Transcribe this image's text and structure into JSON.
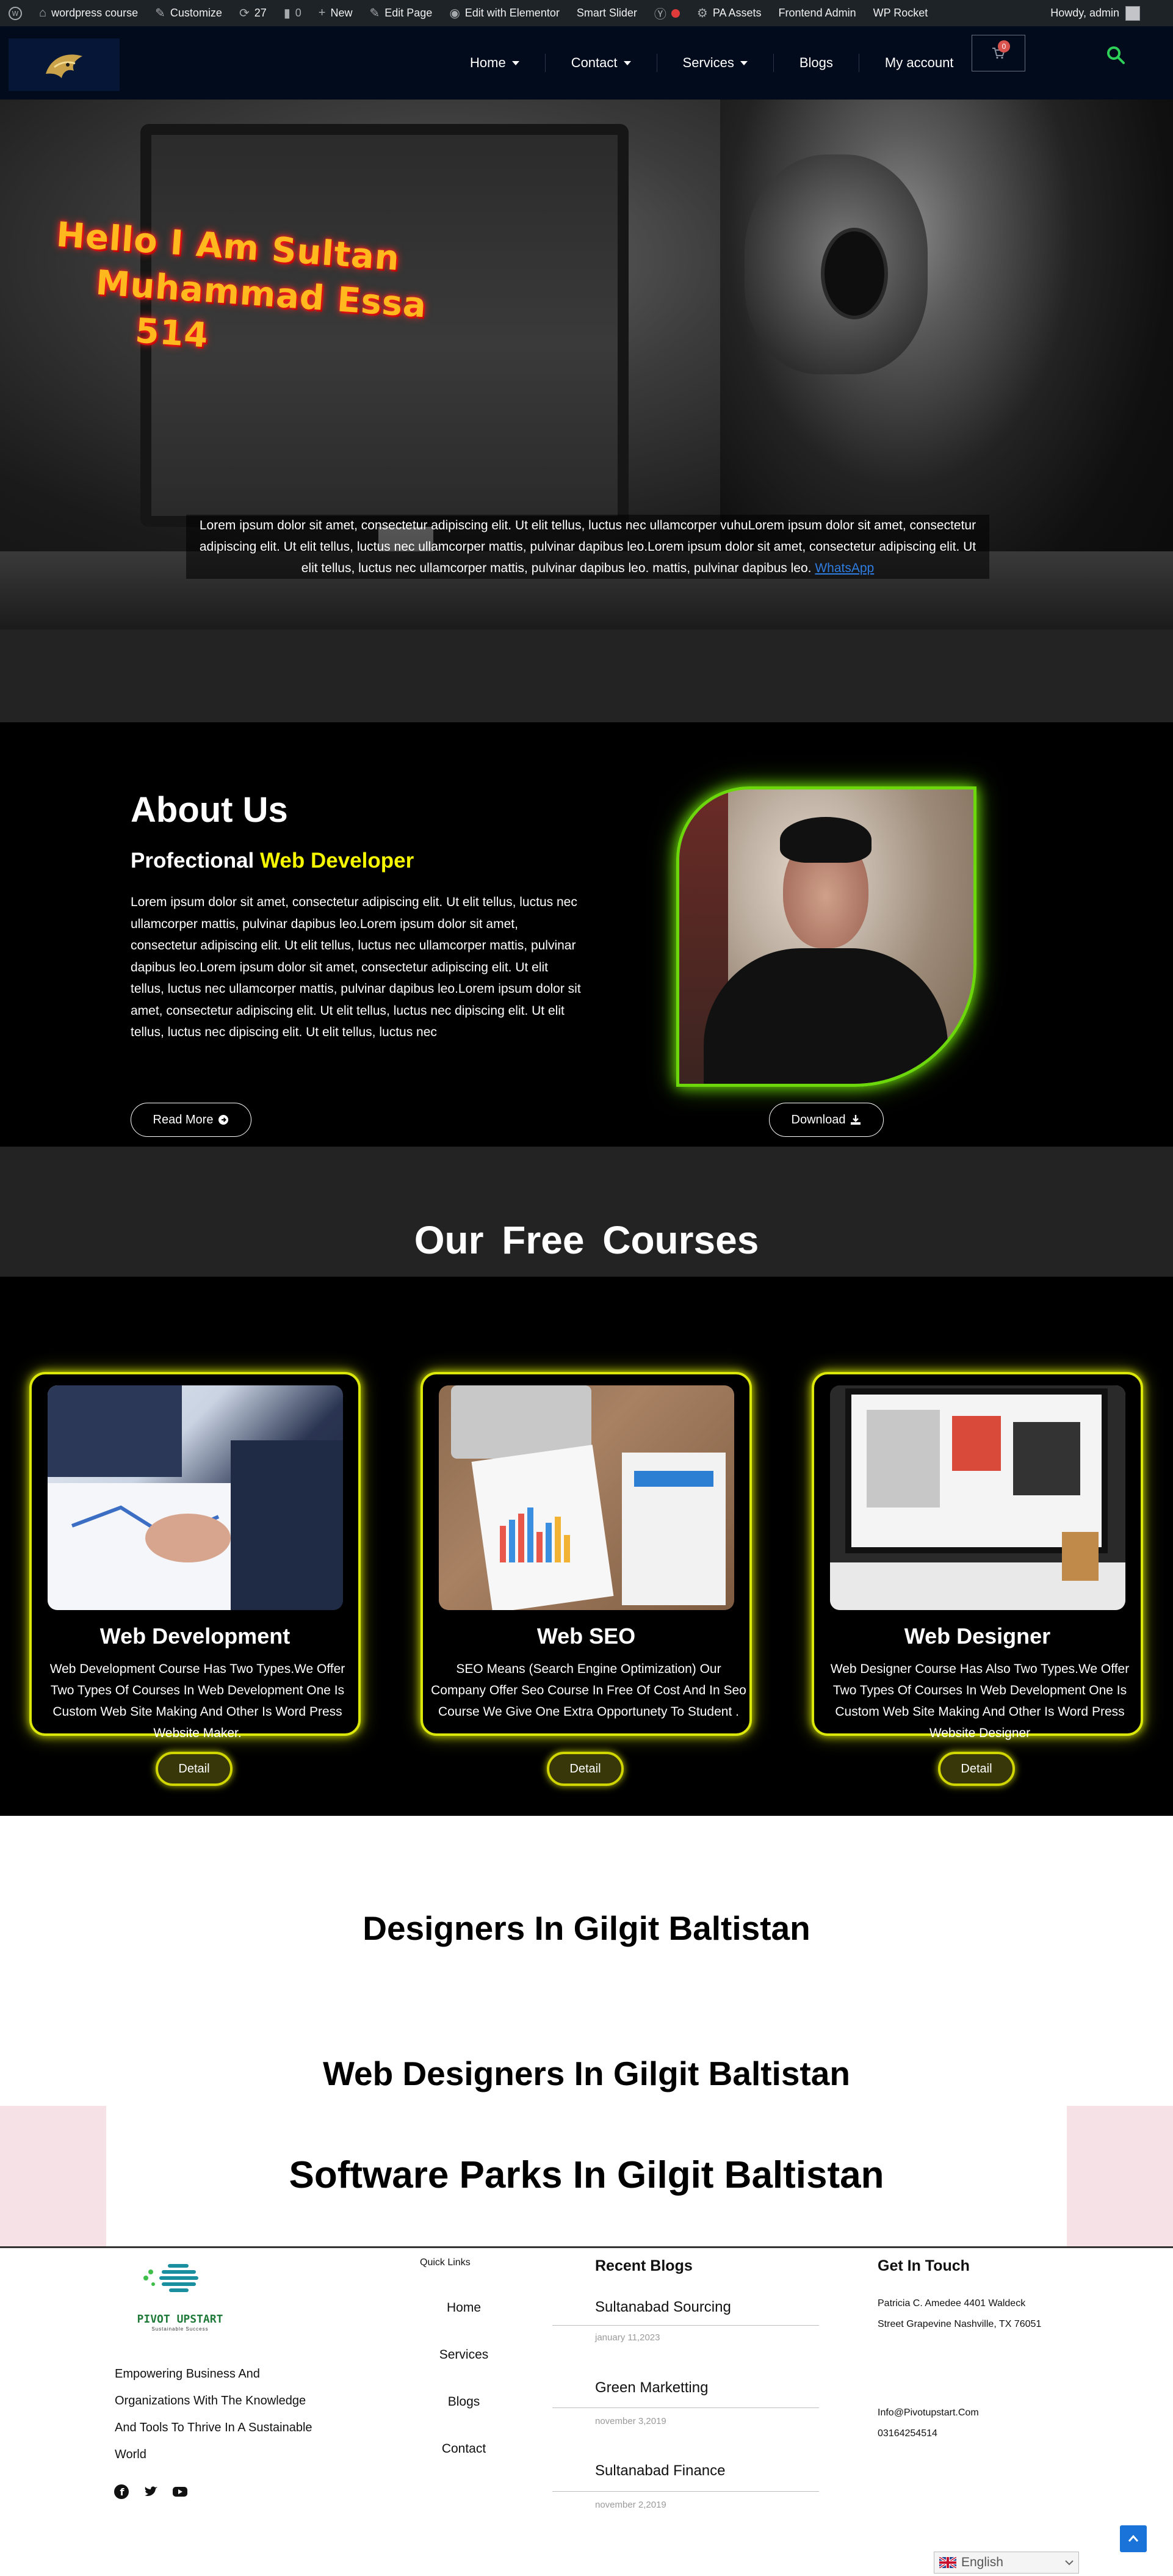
{
  "adminbar": {
    "site_name": "wordpress course",
    "customize": "Customize",
    "updates": "27",
    "comments": "0",
    "new": "New",
    "edit_page": "Edit Page",
    "elementor": "Edit with Elementor",
    "smart_slider": "Smart Slider",
    "pa_assets": "PA Assets",
    "frontend_admin": "Frontend Admin",
    "wp_rocket": "WP Rocket",
    "howdy": "Howdy, admin"
  },
  "nav": {
    "items": [
      "Home",
      "Contact",
      "Services",
      "Blogs",
      "My account"
    ],
    "cart_count": "0"
  },
  "hero": {
    "title_lines": [
      "Hello I Am Sultan",
      "Muhammad Essa",
      "514"
    ],
    "text": "Lorem ipsum dolor sit amet, consectetur adipiscing elit. Ut elit tellus, luctus nec ullamcorper vuhuLorem ipsum dolor sit amet, consectetur adipiscing elit. Ut elit tellus, luctus nec ullamcorper mattis, pulvinar dapibus leo.Lorem ipsum dolor sit amet, consectetur adipiscing elit. Ut elit tellus, luctus nec ullamcorper mattis, pulvinar dapibus leo. mattis, pulvinar dapibus leo.",
    "link": "WhatsApp"
  },
  "about": {
    "title": "About Us",
    "subtitle_plain": "Profectional",
    "subtitle_highlight": "Web Developer",
    "body": "Lorem ipsum dolor sit amet, consectetur adipiscing elit. Ut elit tellus, luctus nec ullamcorper mattis, pulvinar dapibus leo.Lorem ipsum dolor sit amet, consectetur adipiscing elit. Ut elit tellus, luctus nec ullamcorper mattis, pulvinar dapibus leo.Lorem ipsum dolor sit amet, consectetur adipiscing elit. Ut elit tellus, luctus nec ullamcorper mattis, pulvinar dapibus leo.Lorem ipsum dolor sit amet, consectetur adipiscing elit. Ut elit tellus, luctus nec dipiscing elit. Ut elit tellus, luctus nec dipiscing elit. Ut elit tellus, luctus nec",
    "read_more": "Read More",
    "download": "Download"
  },
  "courses": {
    "heading": "Our Free Courses",
    "detail_label": "Detail",
    "items": [
      {
        "title": "Web Development",
        "text": "Web Development Course Has Two Types.We Offer Two Types Of Courses In Web Development One Is Custom Web Site Making And Other Is Word Press Website Maker."
      },
      {
        "title": "Web SEO",
        "text": "SEO Means (Search Engine Optimization) Our Company Offer Seo Course In Free Of Cost And In Seo Course We Give One Extra Opportunety To Student ."
      },
      {
        "title": "Web Designer",
        "text": "Web Designer Course Has Also Two Types.We Offer Two Types Of Courses In Web Development One Is Custom Web Site Making And Other Is Word Press Website Designer"
      }
    ]
  },
  "headings": {
    "h1": "Designers In Gilgit Baltistan",
    "h2": "Web Designers In Gilgit Baltistan",
    "h3": "Software Parks In Gilgit Baltistan"
  },
  "footer": {
    "brand": "PIVOT UPSTART",
    "brand_tag": "Sustainable Success",
    "about": [
      "Empowering Business And",
      "Organizations With The Knowledge",
      "And Tools To Thrive In A Sustainable",
      "World"
    ],
    "quick_links_title": "Quick Links",
    "quick_links": [
      "Home",
      "Services",
      "Blogs",
      "Contact"
    ],
    "recent_title": "Recent Blogs",
    "posts": [
      {
        "title": "Sultanabad Sourcing",
        "date": "january 11,2023"
      },
      {
        "title": "Green Marketting",
        "date": "november 3,2019"
      },
      {
        "title": "Sultanabad Finance",
        "date": "november 2,2019"
      }
    ],
    "contact_title": "Get In Touch",
    "address": [
      "Patricia C. Amedee 4401 Waldeck",
      "Street Grapevine Nashville, TX 76051"
    ],
    "email": "Info@Pivotupstart.Com",
    "phone": "03164254514",
    "language": "English"
  }
}
